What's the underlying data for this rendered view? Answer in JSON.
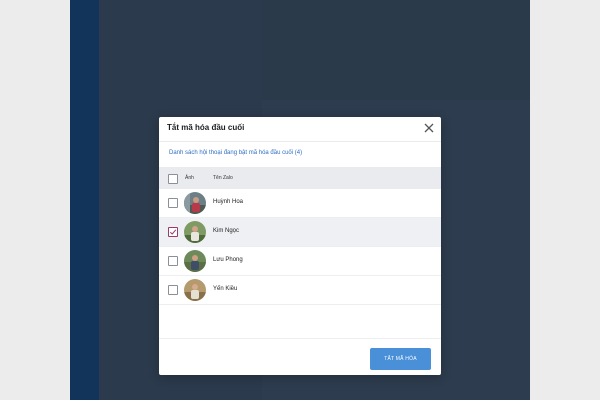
{
  "dialog": {
    "title": "Tắt mã hóa đầu cuối",
    "list_caption": "Danh sách hội thoại đang bật mã hóa đầu cuối (4)",
    "columns": {
      "avatar": "Ảnh",
      "name": "Tên Zalo"
    },
    "rows": [
      {
        "name": "Huỳnh Hoa",
        "checked": false
      },
      {
        "name": "Kim Ngọc",
        "checked": true
      },
      {
        "name": "Lưu Phong",
        "checked": false
      },
      {
        "name": "Yến Kiều",
        "checked": false
      }
    ],
    "primary_button": "TẮT MÃ HÓA"
  },
  "colors": {
    "accent": "#4a90d9",
    "check_mark": "#9b3a6b",
    "caption_link": "#2f6fc4",
    "overlay_sidebar": "#12335a"
  },
  "icons": {
    "close": "close-icon",
    "check": "check-icon"
  }
}
